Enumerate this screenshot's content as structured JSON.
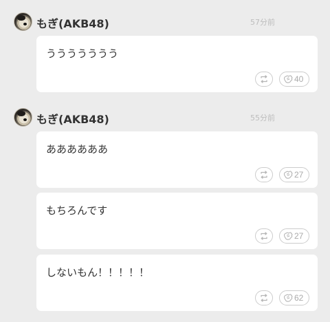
{
  "posts": [
    {
      "username": "もぎ(AKB48)",
      "timestamp": "57分前",
      "messages": [
        {
          "text": "ううううううう",
          "clap_count": "40"
        }
      ]
    },
    {
      "username": "もぎ(AKB48)",
      "timestamp": "55分前",
      "messages": [
        {
          "text": "ああああああ",
          "clap_count": "27"
        },
        {
          "text": "もちろんです",
          "clap_count": "27"
        },
        {
          "text": "しないもん！！！！！",
          "clap_count": "62"
        }
      ]
    }
  ],
  "icons": {
    "repost": "repost-icon",
    "clap": "clap-icon"
  },
  "colors": {
    "background": "#ececec",
    "card": "#ffffff",
    "text": "#333333",
    "muted": "#bdbdbd",
    "button_border": "#cccccc"
  }
}
